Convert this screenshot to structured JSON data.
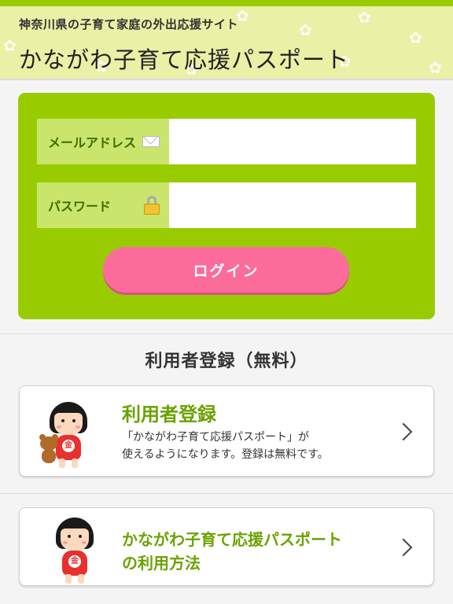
{
  "header": {
    "subtitle": "神奈川県の子育て家庭の外出応援サイト",
    "title": "かながわ子育て応援パスポート"
  },
  "login": {
    "email_label": "メールアドレス",
    "password_label": "パスワード",
    "email_value": "",
    "password_value": "",
    "button_label": "ログイン",
    "email_icon": "envelope-icon",
    "password_icon": "lock-icon"
  },
  "registration": {
    "section_title": "利用者登録（無料）",
    "cards": [
      {
        "title": "利用者登録",
        "description_line1": "「かながわ子育て応援パスポート」が",
        "description_line2": "使えるようになります。登録は無料です。"
      },
      {
        "title_line1": "かながわ子育て応援パスポート",
        "title_line2": "の利用方法"
      }
    ]
  },
  "mascot_badge": "金",
  "colors": {
    "accent_green": "#99cc00",
    "label_green": "#c9e56b",
    "button_pink": "#fb6c9b",
    "header_bg": "#eaf0a6",
    "card_title_green": "#6aa300"
  }
}
